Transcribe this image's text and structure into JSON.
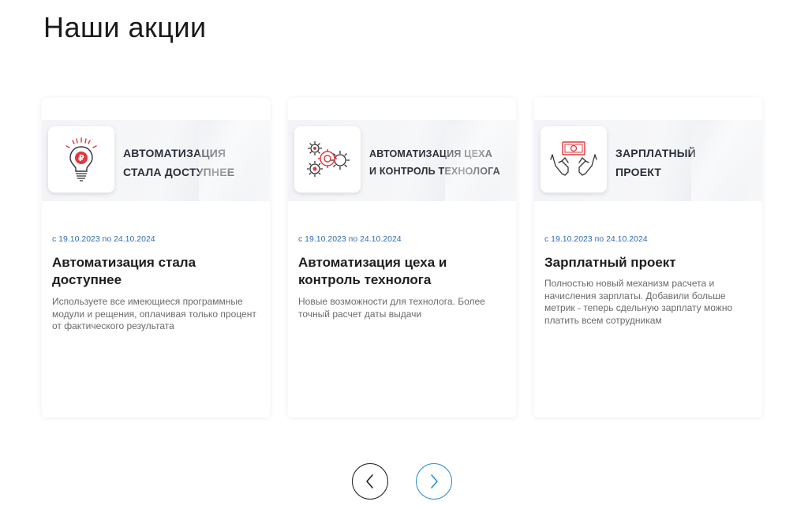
{
  "page": {
    "title": "Наши акции"
  },
  "promos": [
    {
      "icon": "lightbulb-ruble-icon",
      "banner_line1": "АВТОМАТИЗАЦИЯ",
      "banner_line2": "СТАЛА ДОСТУПНЕЕ",
      "dates": "с 19.10.2023 по 24.10.2024",
      "title": "Автоматизация стала доступнее",
      "description": "Используете все имеющиеся программные модули и рещения, оплачивая только процент от фактического результата"
    },
    {
      "icon": "gears-icon",
      "banner_line1": "АВТОМАТИЗАЦИЯ ЦЕХА",
      "banner_line2": "И КОНТРОЛЬ ТЕХНОЛОГА",
      "dates": "с 19.10.2023 по 24.10.2024",
      "title": "Автоматизация цеха и контроль технолога",
      "description": "Новые возможности для технолога. Более точный расчет даты выдачи"
    },
    {
      "icon": "hands-money-icon",
      "banner_line1": "ЗАРПЛАТНЫЙ",
      "banner_line2": "ПРОЕКТ",
      "dates": "с 19.10.2023 по 24.10.2024",
      "title": "Зарплатный проект",
      "description": "Полностью новый механизм расчета и начисления зарплаты. Добавили больше метрик - теперь сдельную зарплату можно платить всем сотрудникам"
    }
  ],
  "carousel": {
    "prev_icon": "chevron-left-icon",
    "next_icon": "chevron-right-icon"
  },
  "colors": {
    "accent": "#2d8fd9",
    "icon_red": "#e0393e",
    "date_blue": "#2f6db3"
  }
}
